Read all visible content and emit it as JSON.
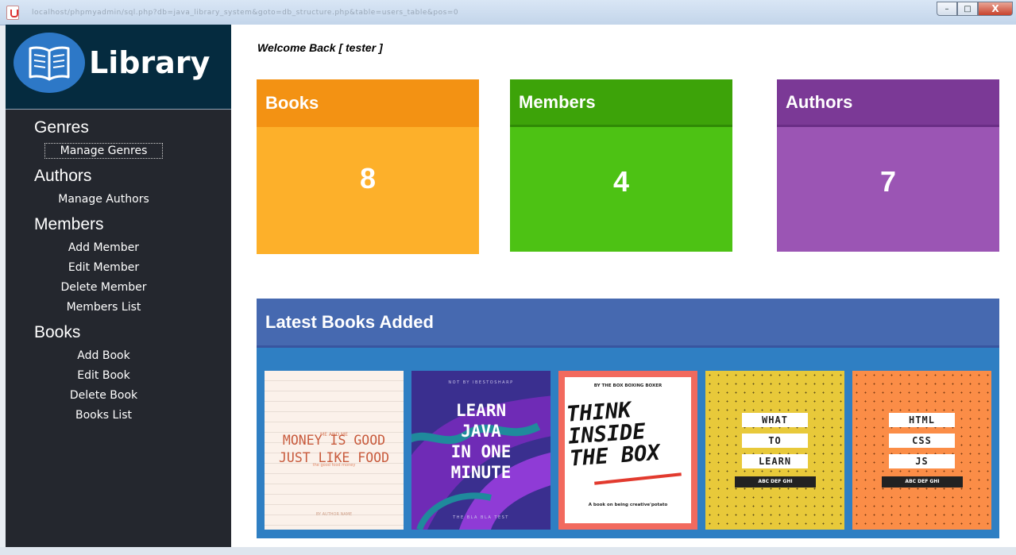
{
  "window": {
    "url": "localhost/phpmyadmin/sql.php?db=java_library_system&goto=db_structure.php&table=users_table&pos=0",
    "controls": {
      "minimize": "–",
      "maximize": "□",
      "close": "X"
    }
  },
  "brand": {
    "title": "Library",
    "icon": "open-book-icon"
  },
  "sidebar": {
    "groups": [
      {
        "title": "Genres",
        "items": [
          "Manage Genres"
        ]
      },
      {
        "title": "Authors",
        "items": [
          "Manage Authors"
        ]
      },
      {
        "title": "Members",
        "items": [
          "Add Member",
          "Edit Member",
          "Delete Member",
          "Members List"
        ]
      },
      {
        "title": "Books",
        "items": [
          "Add Book",
          "Edit Book",
          "Delete Book",
          "Books List"
        ]
      }
    ]
  },
  "welcome": "Welcome Back [ tester ]",
  "cards": [
    {
      "title": "Books",
      "value": "8",
      "head_color": "#f39213",
      "body_color": "#fdb02a"
    },
    {
      "title": "Members",
      "value": "4",
      "head_color": "#3da309",
      "body_color": "#4dc214"
    },
    {
      "title": "Authors",
      "value": "7",
      "head_color": "#7b3996",
      "body_color": "#9b55b4"
    }
  ],
  "latest": {
    "title": "Latest Books Added",
    "books": [
      {
        "top": "ME AND ME",
        "title1": "MONEY IS GOOD",
        "title2": "JUST LIKE FOOD",
        "sub": "the good food money",
        "author": "BY AUTHOR NAME"
      },
      {
        "top": "NOT BY IBESTOSHARP",
        "lines": [
          "LEARN",
          "JAVA",
          "IN ONE",
          "MINUTE"
        ],
        "bottom": "THE BLA BLA TEST"
      },
      {
        "top": "BY THE BOX BOXING BOXER",
        "lines": [
          "THINK",
          "INSIDE",
          "THE BOX"
        ],
        "bottom": "A book on being creative'potato"
      },
      {
        "lines": [
          "WHAT",
          "TO",
          "LEARN"
        ],
        "bottom": "ABC DEF GHI"
      },
      {
        "lines": [
          "HTML",
          "CSS",
          "JS"
        ],
        "bottom": "ABC DEF GHI"
      }
    ]
  }
}
